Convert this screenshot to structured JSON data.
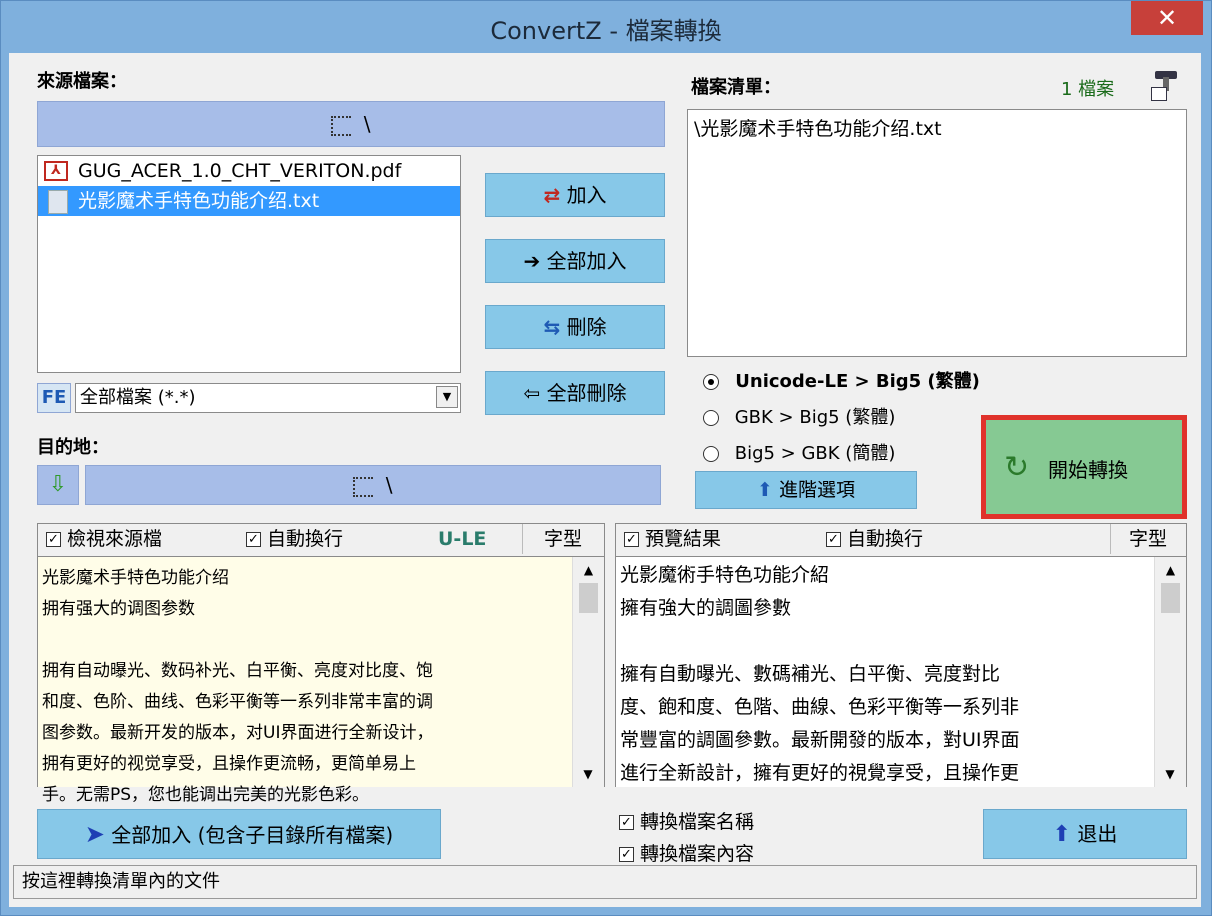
{
  "window": {
    "title": "ConvertZ - 檔案轉換",
    "close": "✕"
  },
  "source": {
    "label": "來源檔案：",
    "path": "\\",
    "files": [
      {
        "name": "GUG_ACER_1.0_CHT_VERITON.pdf",
        "icon": "pdf-icon"
      },
      {
        "name": "光影魔术手特色功能介绍.txt",
        "icon": "text-file-icon"
      }
    ],
    "filter_badge": "FE",
    "filter": "全部檔案 (*.*)"
  },
  "buttons": {
    "add": "加入",
    "add_all": "全部加入",
    "delete": "刪除",
    "delete_all": "全部刪除",
    "start": "開始轉換",
    "advanced": "進階選項",
    "add_all_sub": "全部加入 (包含子目錄所有檔案)",
    "exit": "退出"
  },
  "filelist": {
    "label": "檔案清單：",
    "count": "1 檔案",
    "items": [
      "\\光影魔术手特色功能介绍.txt"
    ]
  },
  "conversion": {
    "options": [
      {
        "label": "Unicode-LE > Big5 (繁體)",
        "selected": true
      },
      {
        "label": "GBK > Big5 (繁體)",
        "selected": false
      },
      {
        "label": "Big5 > GBK (簡體)",
        "selected": false
      }
    ]
  },
  "destination": {
    "label": "目的地：",
    "path": "\\"
  },
  "source_view": {
    "view_source": "檢視來源檔",
    "wrap": "自動換行",
    "encoding": "U-LE",
    "font": "字型",
    "text": [
      "光影魔术手特色功能介绍",
      "拥有强大的调图参数",
      "",
      "拥有自动曝光、数码补光、白平衡、亮度对比度、饱",
      "和度、色阶、曲线、色彩平衡等一系列非常丰富的调",
      "图参数。最新开发的版本，对UI界面进行全新设计，",
      "拥有更好的视觉享受，且操作更流畅，更简单易上",
      "手。无需PS，您也能调出完美的光影色彩。"
    ]
  },
  "preview": {
    "preview_result": "預覽結果",
    "wrap": "自動換行",
    "font": "字型",
    "text": [
      "光影魔術手特色功能介紹",
      "擁有強大的調圖參數",
      "",
      "擁有自動曝光、數碼補光、白平衡、亮度對比",
      "度、飽和度、色階、曲線、色彩平衡等一系列非",
      "常豐富的調圖參數。最新開發的版本，對UI界面",
      "進行全新設計，擁有更好的視覺享受，且操作更"
    ]
  },
  "options": {
    "convert_names": "轉換檔案名稱",
    "convert_content": "轉換檔案內容"
  },
  "status": "按這裡轉換清單內的文件"
}
